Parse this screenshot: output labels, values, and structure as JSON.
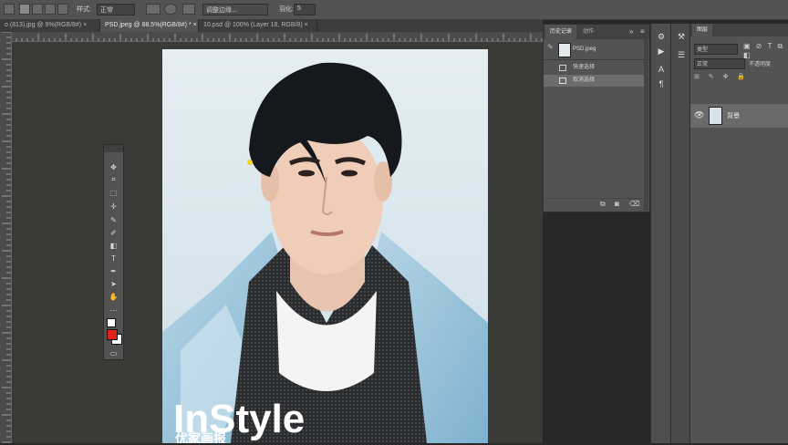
{
  "options_bar": {
    "style_label": "样式:",
    "style_value": "正常",
    "width_label": "调整边缘...",
    "feather_label": "羽化:",
    "feather_value": "5"
  },
  "tabs": [
    {
      "label": "o (813).jpg @ 9%(RGB/8#)",
      "close": "×"
    },
    {
      "label": "PSD.jpeg @ 88.5%(RGB/8#) *",
      "close": "×",
      "active": true
    },
    {
      "label": "10.psd @ 100% (Layer 18, RGB/8)",
      "close": "×"
    }
  ],
  "photo": {
    "magazine_title": "InStyle",
    "magazine_sub": "优家画报"
  },
  "history_panel": {
    "tab_history": "历史记录",
    "tab_actions": "动作",
    "snapshot_label": "PSD.jpeg",
    "items": [
      "快速选择",
      "取消选择"
    ]
  },
  "layers_panel": {
    "tab": "图层",
    "filter_label": "类型",
    "blend_mode": "正常",
    "opacity_label": "不透明度",
    "layer_name": "背景"
  }
}
